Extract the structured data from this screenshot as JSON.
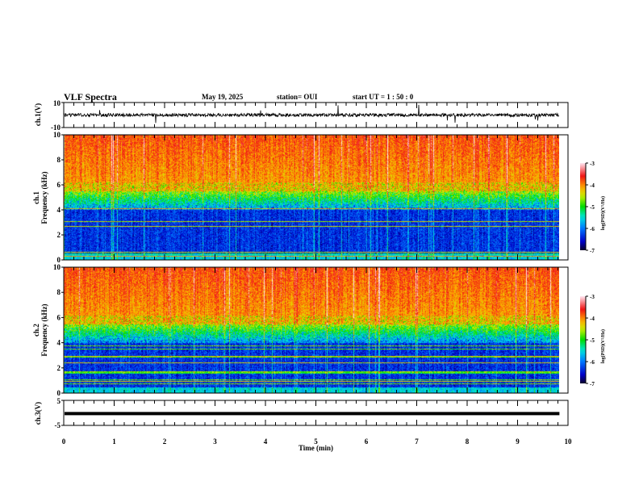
{
  "header": {
    "title": "VLF Spectra",
    "date": "May 19, 2025",
    "station": "station= OUI",
    "start": "start  UT =   1 : 50 : 0"
  },
  "chart_data": [
    {
      "type": "line",
      "name": "ch1",
      "ylabel": "ch.1(V)",
      "ylim": [
        -10,
        10
      ],
      "yticks": [
        "10",
        "-10"
      ],
      "baseline": 0,
      "xlim": [
        0,
        10
      ]
    },
    {
      "type": "heatmap",
      "name": "ch1-spectrogram",
      "ylabel": "ch.1\nFrequency (kHz)",
      "ylabel_line1": "ch.1",
      "ylabel_line2": "Frequency (kHz)",
      "ylim": [
        0,
        10
      ],
      "yticks": [
        "0",
        "2",
        "4",
        "6",
        "8",
        "10"
      ],
      "xlim": [
        0,
        10
      ],
      "data_end_min": 9.83,
      "colorbar": {
        "label": "log(PSD)(V²/Hz)",
        "range": [
          -7,
          -3
        ],
        "ticks": [
          "-3",
          "-4",
          "-5",
          "-6",
          "-7"
        ]
      }
    },
    {
      "type": "heatmap",
      "name": "ch2-spectrogram",
      "ylabel_line1": "ch.2",
      "ylabel_line2": "Frequency (kHz)",
      "ylim": [
        0,
        10
      ],
      "yticks": [
        "0",
        "2",
        "4",
        "6",
        "8",
        "10"
      ],
      "xlim": [
        0,
        10
      ],
      "data_end_min": 9.83,
      "colorbar": {
        "label": "log(PSD)(V²/Hz)",
        "range": [
          -7,
          -3
        ],
        "ticks": [
          "-3",
          "-4",
          "-5",
          "-6",
          "-7"
        ]
      }
    },
    {
      "type": "line",
      "name": "ch3",
      "ylabel": "ch.3(V)",
      "ylim": [
        -5,
        5
      ],
      "yticks": [
        "5",
        "-5"
      ],
      "constant_value": -0.3,
      "xlim": [
        0,
        10
      ],
      "xlabel": "Time (min)",
      "xticks": [
        "0",
        "1",
        "2",
        "3",
        "4",
        "5",
        "6",
        "7",
        "8",
        "9",
        "10"
      ]
    }
  ]
}
